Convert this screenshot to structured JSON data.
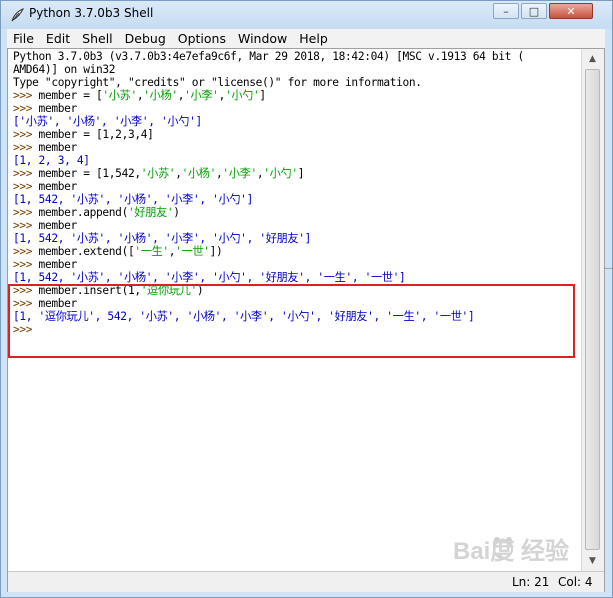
{
  "window": {
    "title": "Python 3.7.0b3 Shell",
    "minimize": "–",
    "maximize": "□",
    "close": "✕"
  },
  "menu": [
    "File",
    "Edit",
    "Shell",
    "Debug",
    "Options",
    "Window",
    "Help"
  ],
  "shell_lines": [
    {
      "text": "Python 3.7.0b3 (v3.7.0b3:4e7efa9c6f, Mar 29 2018, 18:42:04) [MSC v.1913 64 bit (",
      "style": "black"
    },
    {
      "text": "AMD64)] on win32",
      "style": "black"
    },
    {
      "text": "Type \"copyright\", \"credits\" or \"license()\" for more information.",
      "style": "black"
    },
    {
      "text": ">>> member = ['小苏','小杨','小李','小勺']",
      "style": "input"
    },
    {
      "text": ">>> member",
      "style": "input"
    },
    {
      "text": "['小苏', '小杨', '小李', '小勺']",
      "style": "out"
    },
    {
      "text": ">>> member = [1,2,3,4]",
      "style": "input"
    },
    {
      "text": ">>> member",
      "style": "input"
    },
    {
      "text": "[1, 2, 3, 4]",
      "style": "out"
    },
    {
      "text": ">>> member = [1,542,'小苏','小杨','小李','小勺']",
      "style": "input"
    },
    {
      "text": ">>> member",
      "style": "input"
    },
    {
      "text": "[1, 542, '小苏', '小杨', '小李', '小勺']",
      "style": "out"
    },
    {
      "text": ">>> member.append('好朋友')",
      "style": "input"
    },
    {
      "text": ">>> member",
      "style": "input"
    },
    {
      "text": "[1, 542, '小苏', '小杨', '小李', '小勺', '好朋友']",
      "style": "out"
    },
    {
      "text": ">>> member.extend(['一生','一世'])",
      "style": "input"
    },
    {
      "text": ">>> member",
      "style": "input"
    },
    {
      "text": "[1, 542, '小苏', '小杨', '小李', '小勺', '好朋友', '一生', '一世']",
      "style": "out"
    },
    {
      "text": ">>> member.insert(1,'逗你玩儿')",
      "style": "input"
    },
    {
      "text": ">>> member",
      "style": "input"
    },
    {
      "text": "[1, '逗你玩儿', 542, '小苏', '小杨', '小李', '小勺', '好朋友', '一生', '一世']",
      "style": "out"
    },
    {
      "text": ">>>",
      "style": "prompt"
    }
  ],
  "status": {
    "line": "Ln: 21",
    "col": "Col: 4"
  },
  "watermark": "Bai度 经验"
}
